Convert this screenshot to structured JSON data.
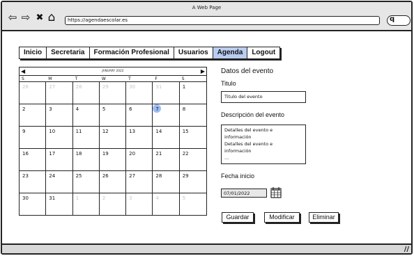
{
  "window": {
    "title": "A Web Page"
  },
  "browser": {
    "url": "https://agendaescolar.es",
    "back_glyph": "⇦",
    "forward_glyph": "⇨",
    "stop_glyph": "✖",
    "home_glyph": "⌂"
  },
  "menu": {
    "items": [
      {
        "label": "Inicio"
      },
      {
        "label": "Secretaria"
      },
      {
        "label": "Formación Profesional"
      },
      {
        "label": "Usuarios"
      },
      {
        "label": "Agenda",
        "active": true
      },
      {
        "label": "Logout"
      }
    ]
  },
  "calendar": {
    "month_label": "JANUARY 2022",
    "prev_glyph": "◀",
    "next_glyph": "▶",
    "weekdays": [
      "S",
      "M",
      "T",
      "W",
      "T",
      "F",
      "S"
    ],
    "days": [
      {
        "n": "26",
        "muted": true
      },
      {
        "n": "27",
        "muted": true
      },
      {
        "n": "28",
        "muted": true
      },
      {
        "n": "29",
        "muted": true
      },
      {
        "n": "30",
        "muted": true
      },
      {
        "n": "31",
        "muted": true
      },
      {
        "n": "1"
      },
      {
        "n": "2"
      },
      {
        "n": "3"
      },
      {
        "n": "4"
      },
      {
        "n": "5"
      },
      {
        "n": "6"
      },
      {
        "n": "7",
        "selected": true
      },
      {
        "n": "8"
      },
      {
        "n": "9"
      },
      {
        "n": "10"
      },
      {
        "n": "11"
      },
      {
        "n": "12"
      },
      {
        "n": "13"
      },
      {
        "n": "14"
      },
      {
        "n": "15"
      },
      {
        "n": "16"
      },
      {
        "n": "17"
      },
      {
        "n": "18"
      },
      {
        "n": "19"
      },
      {
        "n": "20"
      },
      {
        "n": "21"
      },
      {
        "n": "22"
      },
      {
        "n": "23"
      },
      {
        "n": "24"
      },
      {
        "n": "25"
      },
      {
        "n": "26"
      },
      {
        "n": "27"
      },
      {
        "n": "28"
      },
      {
        "n": "29"
      },
      {
        "n": "30"
      },
      {
        "n": "31"
      },
      {
        "n": "1",
        "muted": true
      },
      {
        "n": "2",
        "muted": true
      },
      {
        "n": "3",
        "muted": true
      },
      {
        "n": "4",
        "muted": true
      },
      {
        "n": "5",
        "muted": true
      }
    ],
    "selected_color": "#9dbcf2"
  },
  "event_form": {
    "heading": "Datos del evento",
    "title_label": "Titulo",
    "title_value": "Titulo del evento",
    "description_label": "Descripción del evento",
    "description_lines": [
      "Detalles del evento e",
      "información",
      "Detalles del evento e",
      "información",
      "..."
    ],
    "start_date_label": "Fecha inicio",
    "start_date_value": "07/01/2022",
    "buttons": {
      "save": "Guardar",
      "modify": "Modificar",
      "delete": "Eliminar"
    }
  },
  "colors": {
    "active_tab": "#b9cdf0",
    "chrome": "#e6e6e6"
  }
}
